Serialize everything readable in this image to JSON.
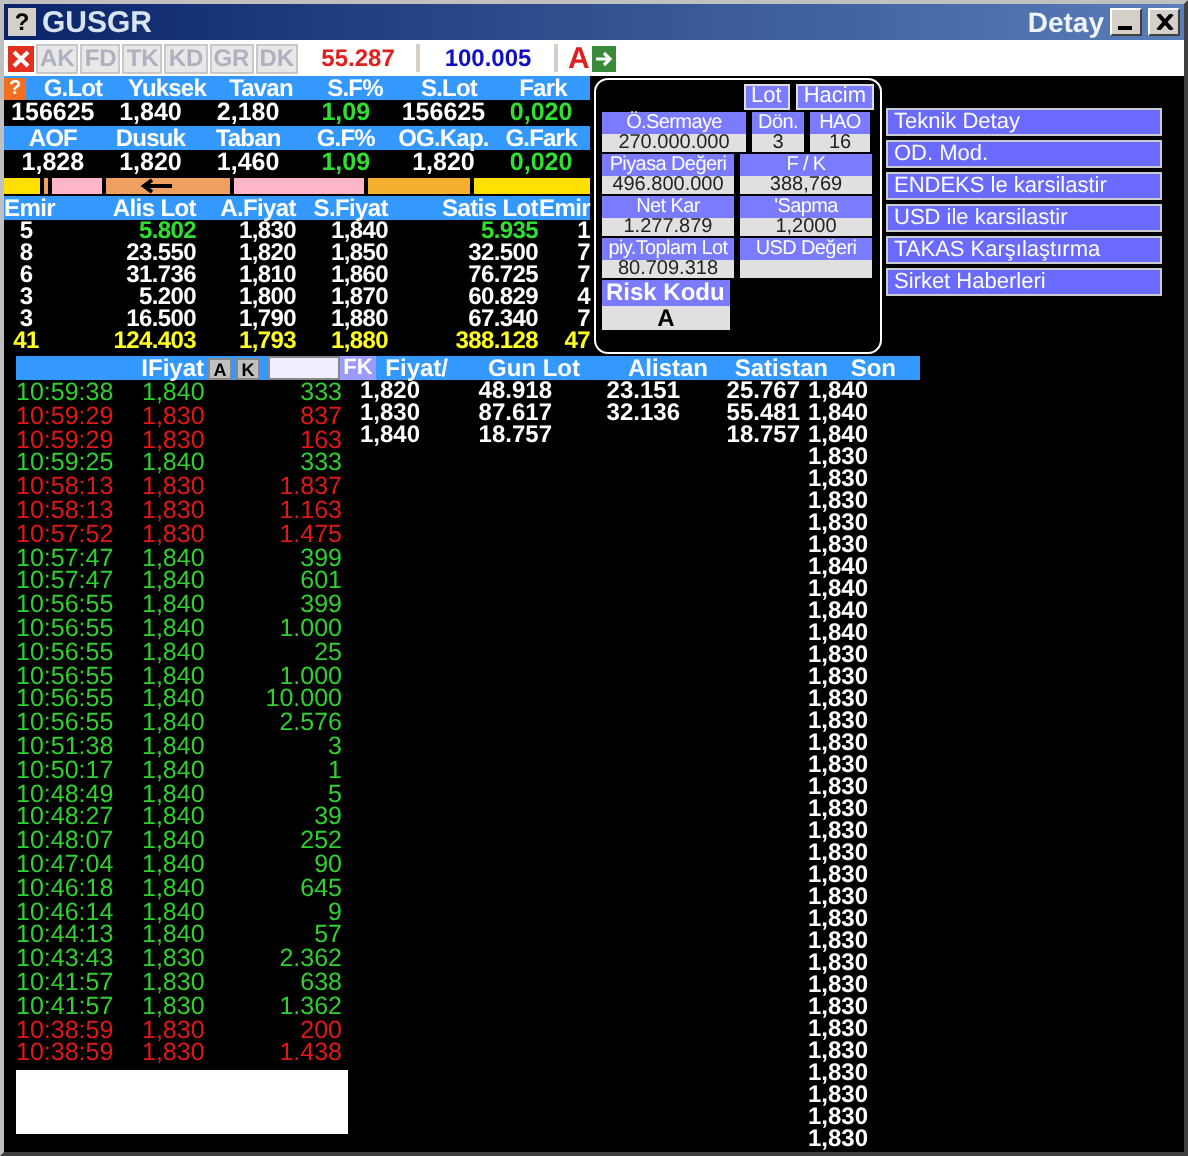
{
  "window": {
    "help": "?",
    "title": "GUSGR",
    "subtitle": "Detay"
  },
  "toolbar": {
    "buttons": [
      "AK",
      "FD",
      "TK",
      "KD",
      "GR",
      "DK"
    ],
    "value_1": "55.287",
    "value_2": "100.005",
    "mode": "A"
  },
  "summary_help": "?",
  "summary": [
    {
      "headers": [
        "G.Lot",
        "Yuksek",
        "Tavan",
        "S.F%",
        "S.Lot",
        "Fark"
      ],
      "values": [
        {
          "text": "156625",
          "kind": "plain"
        },
        {
          "text": "1,840",
          "kind": "plain"
        },
        {
          "text": "2,180",
          "kind": "plain"
        },
        {
          "text": "1,09",
          "kind": "up"
        },
        {
          "text": "156625",
          "kind": "plain"
        },
        {
          "text": "0,020",
          "kind": "up"
        }
      ]
    },
    {
      "headers": [
        "AOF",
        "Dusuk",
        "Taban",
        "G.F%",
        "OG.Kap.",
        "G.Fark"
      ],
      "values": [
        {
          "text": "1,828",
          "kind": "plain"
        },
        {
          "text": "1,820",
          "kind": "plain"
        },
        {
          "text": "1,460",
          "kind": "plain"
        },
        {
          "text": "1,09",
          "kind": "up"
        },
        {
          "text": "1,820",
          "kind": "plain"
        },
        {
          "text": "0,020",
          "kind": "up"
        }
      ]
    }
  ],
  "depth": {
    "columns": [
      "Emir",
      "Alis Lot",
      "A.Fiyat",
      "S.Fiyat",
      "Satis Lot",
      "Emir"
    ],
    "rows": [
      {
        "kind": "best",
        "cells": [
          "5",
          "5.802",
          "1,830",
          "1,840",
          "5.935",
          "1"
        ]
      },
      {
        "kind": "normal",
        "cells": [
          "8",
          "23.550",
          "1,820",
          "1,850",
          "32.500",
          "7"
        ]
      },
      {
        "kind": "normal",
        "cells": [
          "6",
          "31.736",
          "1,810",
          "1,860",
          "76.725",
          "7"
        ]
      },
      {
        "kind": "normal",
        "cells": [
          "3",
          "5.200",
          "1,800",
          "1,870",
          "60.829",
          "4"
        ]
      },
      {
        "kind": "normal",
        "cells": [
          "3",
          "16.500",
          "1,790",
          "1,880",
          "67.340",
          "7"
        ]
      },
      {
        "kind": "total",
        "cells": [
          "41",
          "124.403",
          "1,793",
          "1,880",
          "388.128",
          "47"
        ]
      }
    ]
  },
  "info": {
    "tabs": [
      "Lot",
      "Hacim"
    ],
    "rows": [
      [
        {
          "label": "Ö.Sermaye",
          "value": "270.000.000"
        },
        {
          "label": "Dön.",
          "value": "3"
        },
        {
          "label": "HAO",
          "value": "16"
        }
      ],
      [
        {
          "label": "Piyasa Değeri",
          "value": "496.800.000"
        },
        {
          "label": "F / K",
          "value": "388,769"
        }
      ],
      [
        {
          "label": "Net Kar",
          "value": "1.277.879"
        },
        {
          "label": "'Sapma",
          "value": "1,2000"
        }
      ],
      [
        {
          "label": "piy.Toplam Lot",
          "value": "80.709.318"
        },
        {
          "label": "USD Değeri"
        }
      ]
    ],
    "risk": {
      "label": "Risk Kodu",
      "value": "A"
    }
  },
  "links": [
    "Teknik Detay",
    "OD. Mod.",
    "ENDEKS le karsilastir",
    "USD ile karsilastir",
    "TAKAS Karşılaştırma",
    "Sirket Haberleri"
  ],
  "trades": {
    "header": "IFiyat",
    "buttons": [
      "A",
      "K"
    ],
    "filter": "FK",
    "rows": [
      {
        "time": "10:59:38",
        "price": "1,840",
        "lot": "333",
        "kind": "up"
      },
      {
        "time": "10:59:29",
        "price": "1,830",
        "lot": "837",
        "kind": "down"
      },
      {
        "time": "10:59:29",
        "price": "1,830",
        "lot": "163",
        "kind": "down"
      },
      {
        "time": "10:59:25",
        "price": "1,840",
        "lot": "333",
        "kind": "up"
      },
      {
        "time": "10:58:13",
        "price": "1,830",
        "lot": "1.837",
        "kind": "down"
      },
      {
        "time": "10:58:13",
        "price": "1,830",
        "lot": "1.163",
        "kind": "down"
      },
      {
        "time": "10:57:52",
        "price": "1,830",
        "lot": "1.475",
        "kind": "down"
      },
      {
        "time": "10:57:47",
        "price": "1,840",
        "lot": "399",
        "kind": "up"
      },
      {
        "time": "10:57:47",
        "price": "1,840",
        "lot": "601",
        "kind": "up"
      },
      {
        "time": "10:56:55",
        "price": "1,840",
        "lot": "399",
        "kind": "up"
      },
      {
        "time": "10:56:55",
        "price": "1,840",
        "lot": "1.000",
        "kind": "up"
      },
      {
        "time": "10:56:55",
        "price": "1,840",
        "lot": "25",
        "kind": "up"
      },
      {
        "time": "10:56:55",
        "price": "1,840",
        "lot": "1.000",
        "kind": "up"
      },
      {
        "time": "10:56:55",
        "price": "1,840",
        "lot": "10.000",
        "kind": "up"
      },
      {
        "time": "10:56:55",
        "price": "1,840",
        "lot": "2.576",
        "kind": "up"
      },
      {
        "time": "10:51:38",
        "price": "1,840",
        "lot": "3",
        "kind": "up"
      },
      {
        "time": "10:50:17",
        "price": "1,840",
        "lot": "1",
        "kind": "up"
      },
      {
        "time": "10:48:49",
        "price": "1,840",
        "lot": "5",
        "kind": "up"
      },
      {
        "time": "10:48:27",
        "price": "1,840",
        "lot": "39",
        "kind": "up"
      },
      {
        "time": "10:48:07",
        "price": "1,840",
        "lot": "252",
        "kind": "up"
      },
      {
        "time": "10:47:04",
        "price": "1,840",
        "lot": "90",
        "kind": "up"
      },
      {
        "time": "10:46:18",
        "price": "1,840",
        "lot": "645",
        "kind": "up"
      },
      {
        "time": "10:46:14",
        "price": "1,840",
        "lot": "9",
        "kind": "up"
      },
      {
        "time": "10:44:13",
        "price": "1,840",
        "lot": "57",
        "kind": "up"
      },
      {
        "time": "10:43:43",
        "price": "1,830",
        "lot": "2.362",
        "kind": "up"
      },
      {
        "time": "10:41:57",
        "price": "1,830",
        "lot": "638",
        "kind": "up"
      },
      {
        "time": "10:41:57",
        "price": "1,830",
        "lot": "1.362",
        "kind": "up"
      },
      {
        "time": "10:38:59",
        "price": "1,830",
        "lot": "200",
        "kind": "down"
      },
      {
        "time": "10:38:59",
        "price": "1,830",
        "lot": "1.438",
        "kind": "down"
      }
    ]
  },
  "price_table": {
    "columns": [
      "Fiyat/",
      "Gun Lot",
      "Alistan",
      "Satistan"
    ],
    "rows": [
      [
        "1,820",
        "48.918",
        "23.151",
        "25.767"
      ],
      [
        "1,830",
        "87.617",
        "32.136",
        "55.481"
      ],
      [
        "1,840",
        "18.757",
        "",
        "18.757"
      ]
    ]
  },
  "last": {
    "header": "Son",
    "values": [
      "1,840",
      "1,840",
      "1,840",
      "1,830",
      "1,830",
      "1,830",
      "1,830",
      "1,830",
      "1,840",
      "1,840",
      "1,840",
      "1,840",
      "1,830",
      "1,830",
      "1,830",
      "1,830",
      "1,830",
      "1,830",
      "1,830",
      "1,830",
      "1,830",
      "1,830",
      "1,830",
      "1,830",
      "1,830",
      "1,830",
      "1,830",
      "1,830",
      "1,830",
      "1,830",
      "1,830",
      "1,830",
      "1,830",
      "1,830",
      "1,830"
    ]
  }
}
